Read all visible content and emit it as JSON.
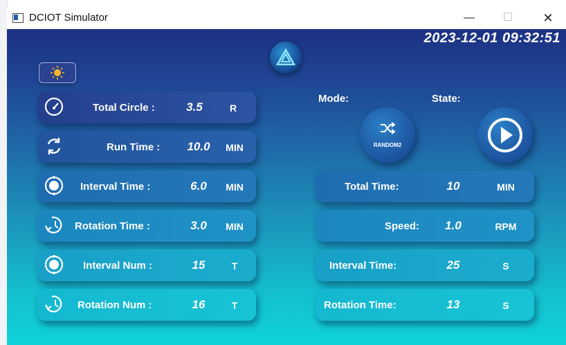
{
  "window": {
    "title": "DCIOT Simulator",
    "minimize": "—",
    "maximize": "☐",
    "close": "✕"
  },
  "datetime": "2023-12-01 09:32:51",
  "left_panel": [
    {
      "label": "Total Circle :",
      "value": "3.5",
      "unit": "R",
      "icon": "speedometer-icon"
    },
    {
      "label": "Run Time :",
      "value": "10.0",
      "unit": "MIN",
      "icon": "refresh-icon"
    },
    {
      "label": "Interval Time :",
      "value": "6.0",
      "unit": "MIN",
      "icon": "target-icon"
    },
    {
      "label": "Rotation Time :",
      "value": "3.0",
      "unit": "MIN",
      "icon": "clock-rotate-icon"
    },
    {
      "label": "Interval Num :",
      "value": "15",
      "unit": "T",
      "icon": "target-icon"
    },
    {
      "label": "Rotation Num :",
      "value": "16",
      "unit": "T",
      "icon": "clock-rotate-icon"
    }
  ],
  "mode": {
    "label": "Mode:",
    "value": "RANDOM2"
  },
  "state": {
    "label": "State:"
  },
  "right_panel": [
    {
      "label": "Total Time:",
      "value": "10",
      "unit": "MIN"
    },
    {
      "label": "Speed:",
      "value": "1.0",
      "unit": "RPM"
    },
    {
      "label": "Interval Time:",
      "value": "25",
      "unit": "S"
    },
    {
      "label": "Rotation Time:",
      "value": "13",
      "unit": "S"
    }
  ],
  "colors": {
    "bg_top": "#1d3183",
    "bg_bottom": "#0fd2d9",
    "text": "#ffffff"
  }
}
